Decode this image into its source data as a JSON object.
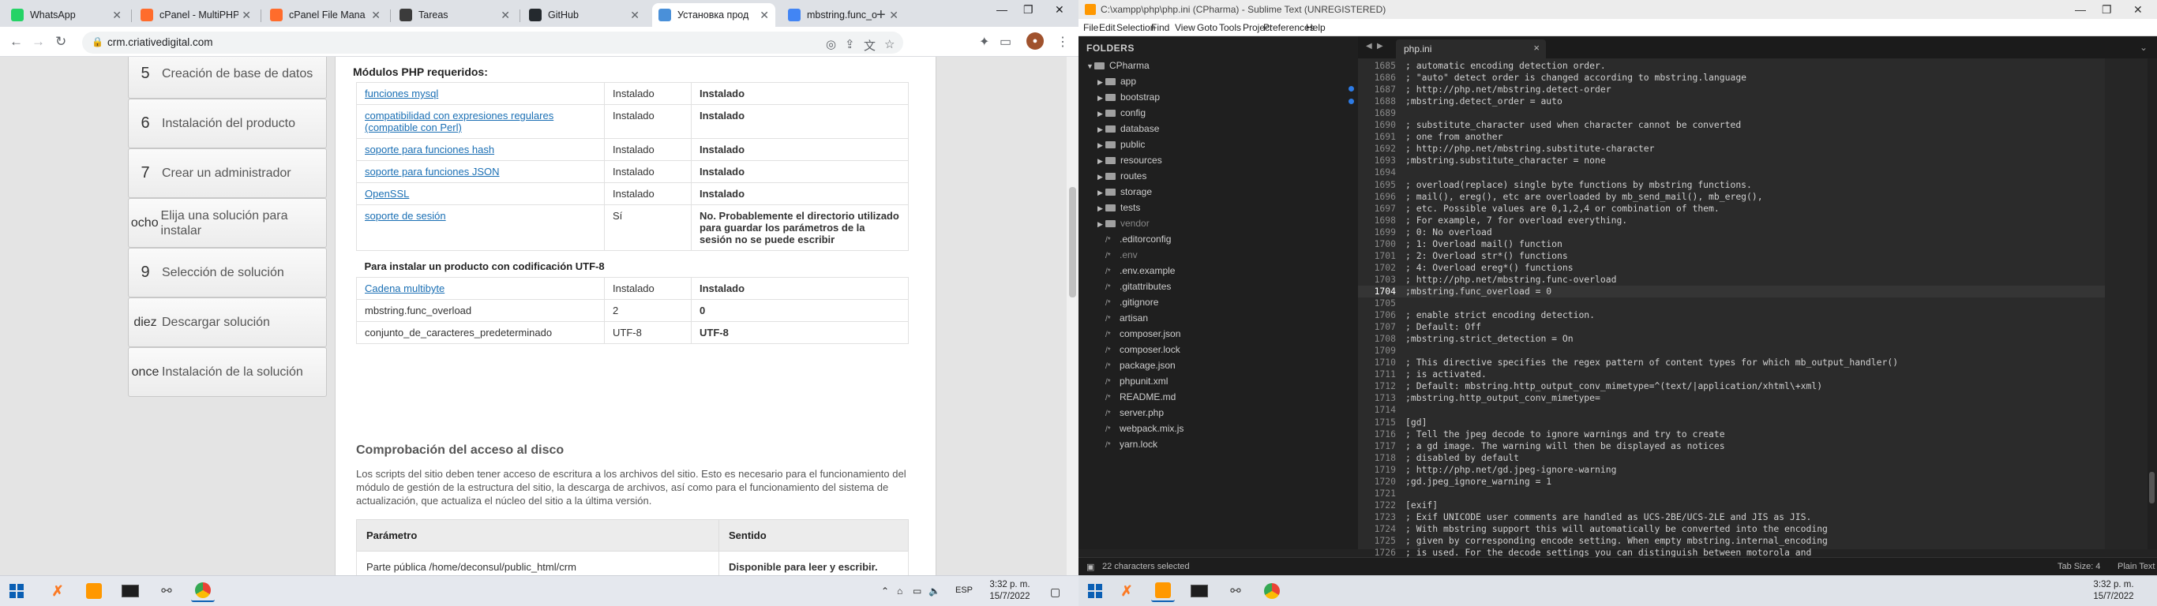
{
  "left": {
    "tabs": [
      {
        "title": "WhatsApp",
        "icon": "whatsapp-icon",
        "color": "#25d366"
      },
      {
        "title": "cPanel - MultiPHP",
        "icon": "cpanel-icon",
        "color": "#ff6c2c"
      },
      {
        "title": "cPanel File Mana",
        "icon": "cpanel-icon",
        "color": "#ff6c2c"
      },
      {
        "title": "Tareas",
        "icon": "tasks-icon",
        "color": "#3b3b3b"
      },
      {
        "title": "GitHub",
        "icon": "github-icon",
        "color": "#24292e"
      },
      {
        "title": "Установка прод",
        "icon": "page-icon",
        "color": "#4a90d9"
      },
      {
        "title": "mbstring.func_o",
        "icon": "google-icon",
        "color": "#4285f4"
      }
    ],
    "url": "crm.criativedigital.com",
    "steps": [
      {
        "num": "5",
        "label": "Creación de base de datos"
      },
      {
        "num": "6",
        "label": "Instalación del producto"
      },
      {
        "num": "7",
        "label": "Crear un administrador"
      },
      {
        "num": "ocho",
        "label": "Elija una solución para instalar"
      },
      {
        "num": "9",
        "label": "Selección de solución"
      },
      {
        "num": "diez",
        "label": "Descargar solución"
      },
      {
        "num": "once",
        "label": "Instalación de la solución"
      }
    ],
    "modules_title": "Módulos PHP requeridos:",
    "modules": [
      {
        "name": "funciones mysql",
        "link": true,
        "current": "Instalado",
        "status": "Instalado",
        "ok": true
      },
      {
        "name": "compatibilidad con expresiones regulares (compatible con Perl)",
        "link": true,
        "current": "Instalado",
        "status": "Instalado",
        "ok": true
      },
      {
        "name": "soporte para funciones hash",
        "link": true,
        "current": "Instalado",
        "status": "Instalado",
        "ok": true
      },
      {
        "name": "soporte para funciones JSON",
        "link": true,
        "current": "Instalado",
        "status": "Instalado",
        "ok": true
      },
      {
        "name": "OpenSSL",
        "link": true,
        "current": "Instalado",
        "status": "Instalado",
        "ok": true
      },
      {
        "name": "soporte de sesión",
        "link": true,
        "current": "Sí",
        "status": "No. Probablemente el directorio utilizado para guardar los parámetros de la sesión no se puede escribir",
        "ok": false
      }
    ],
    "utf8_title": "Para instalar un producto con codificación UTF-8",
    "utf8": [
      {
        "name": "Cadena multibyte",
        "link": true,
        "current": "Instalado",
        "status": "Instalado",
        "ok": true
      },
      {
        "name": "mbstring.func_overload",
        "link": false,
        "current": "2",
        "status": "0",
        "ok": false
      },
      {
        "name": "conjunto_de_caracteres_predeterminado",
        "link": false,
        "current": "UTF-8",
        "status": "UTF-8",
        "ok": true
      }
    ],
    "disk_title": "Comprobación del acceso al disco",
    "disk_text": "Los scripts del sitio deben tener acceso de escritura a los archivos del sitio. Esto es necesario para el funcionamiento del módulo de gestión de la estructura del sitio, la descarga de archivos, así como para el funcionamiento del sistema de actualización, que actualiza el núcleo del sitio a la última versión.",
    "param_head": [
      "Parámetro",
      "Sentido"
    ],
    "param_row": {
      "param": "Parte pública /home/deconsul/public_html/crm",
      "value": "Disponible para leer y escribir."
    },
    "tray": {
      "lang": "ESP",
      "time": "3:32 p. m.",
      "date": "15/7/2022"
    }
  },
  "right": {
    "title": "C:\\xampp\\php\\php.ini (CPharma) - Sublime Text (UNREGISTERED)",
    "menu": [
      "File",
      "Edit",
      "Selection",
      "Find",
      "View",
      "Goto",
      "Tools",
      "Project",
      "Preferences",
      "Help"
    ],
    "folders_header": "FOLDERS",
    "root": "CPharma",
    "folders": [
      "app",
      "bootstrap",
      "config",
      "database",
      "public",
      "resources",
      "routes",
      "storage",
      "tests",
      "vendor"
    ],
    "files": [
      ".editorconfig",
      ".env",
      ".env.example",
      ".gitattributes",
      ".gitignore",
      "artisan",
      "composer.json",
      "composer.lock",
      "package.json",
      "phpunit.xml",
      "README.md",
      "server.php",
      "webpack.mix.js",
      "yarn.lock"
    ],
    "file_tab": "php.ini",
    "current_line": 1704,
    "lines": [
      {
        "n": 1685,
        "t": "; automatic encoding detection order."
      },
      {
        "n": 1686,
        "t": "; \"auto\" detect order is changed according to mbstring.language"
      },
      {
        "n": 1687,
        "t": "; http://php.net/mbstring.detect-order"
      },
      {
        "n": 1688,
        "t": ";mbstring.detect_order = auto"
      },
      {
        "n": 1689,
        "t": ""
      },
      {
        "n": 1690,
        "t": "; substitute_character used when character cannot be converted"
      },
      {
        "n": 1691,
        "t": "; one from another"
      },
      {
        "n": 1692,
        "t": "; http://php.net/mbstring.substitute-character"
      },
      {
        "n": 1693,
        "t": ";mbstring.substitute_character = none"
      },
      {
        "n": 1694,
        "t": ""
      },
      {
        "n": 1695,
        "t": "; overload(replace) single byte functions by mbstring functions."
      },
      {
        "n": 1696,
        "t": "; mail(), ereg(), etc are overloaded by mb_send_mail(), mb_ereg(),"
      },
      {
        "n": 1697,
        "t": "; etc. Possible values are 0,1,2,4 or combination of them."
      },
      {
        "n": 1698,
        "t": "; For example, 7 for overload everything."
      },
      {
        "n": 1699,
        "t": "; 0: No overload"
      },
      {
        "n": 1700,
        "t": "; 1: Overload mail() function"
      },
      {
        "n": 1701,
        "t": "; 2: Overload str*() functions"
      },
      {
        "n": 1702,
        "t": "; 4: Overload ereg*() functions"
      },
      {
        "n": 1703,
        "t": "; http://php.net/mbstring.func-overload"
      },
      {
        "n": 1704,
        "t": ";mbstring.func_overload = 0"
      },
      {
        "n": 1705,
        "t": ""
      },
      {
        "n": 1706,
        "t": "; enable strict encoding detection."
      },
      {
        "n": 1707,
        "t": "; Default: Off"
      },
      {
        "n": 1708,
        "t": ";mbstring.strict_detection = On"
      },
      {
        "n": 1709,
        "t": ""
      },
      {
        "n": 1710,
        "t": "; This directive specifies the regex pattern of content types for which mb_output_handler()"
      },
      {
        "n": 1711,
        "t": "; is activated."
      },
      {
        "n": 1712,
        "t": "; Default: mbstring.http_output_conv_mimetype=^(text/|application/xhtml\\+xml)"
      },
      {
        "n": 1713,
        "t": ";mbstring.http_output_conv_mimetype="
      },
      {
        "n": 1714,
        "t": ""
      },
      {
        "n": 1715,
        "t": "[gd]"
      },
      {
        "n": 1716,
        "t": "; Tell the jpeg decode to ignore warnings and try to create"
      },
      {
        "n": 1717,
        "t": "; a gd image. The warning will then be displayed as notices"
      },
      {
        "n": 1718,
        "t": "; disabled by default"
      },
      {
        "n": 1719,
        "t": "; http://php.net/gd.jpeg-ignore-warning"
      },
      {
        "n": 1720,
        "t": ";gd.jpeg_ignore_warning = 1"
      },
      {
        "n": 1721,
        "t": ""
      },
      {
        "n": 1722,
        "t": "[exif]"
      },
      {
        "n": 1723,
        "t": "; Exif UNICODE user comments are handled as UCS-2BE/UCS-2LE and JIS as JIS."
      },
      {
        "n": 1724,
        "t": "; With mbstring support this will automatically be converted into the encoding"
      },
      {
        "n": 1725,
        "t": "; given by corresponding encode setting. When empty mbstring.internal_encoding"
      },
      {
        "n": 1726,
        "t": "; is used. For the decode settings you can distinguish between motorola and"
      }
    ],
    "status_left": "22 characters selected",
    "tab_size": "Tab Size: 4",
    "syntax": "Plain Text",
    "tray": {
      "time": "3:32 p. m.",
      "date": "15/7/2022"
    }
  }
}
